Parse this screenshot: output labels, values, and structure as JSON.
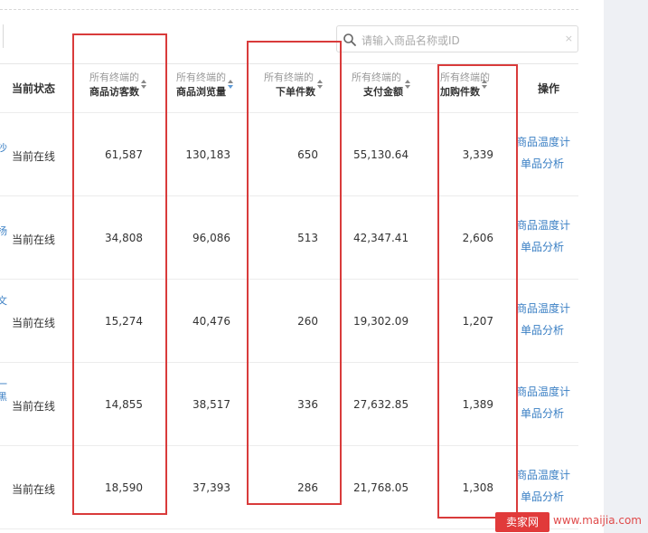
{
  "search": {
    "placeholder": "请输入商品名称或ID",
    "clear_symbol": "×"
  },
  "columns": {
    "status": "当前状态",
    "visitors": {
      "sub": "所有终端的",
      "main": "商品访客数"
    },
    "pageviews": {
      "sub": "所有终端的",
      "main": "商品浏览量"
    },
    "order_items": {
      "sub": "所有终端的",
      "main": "下单件数"
    },
    "payment": {
      "sub": "所有终端的",
      "main": "支付金额"
    },
    "cart_adds": {
      "sub": "所有终端的",
      "main": "加购件数"
    },
    "action": "操作"
  },
  "name_fragments": [
    "沙",
    "杨",
    "文",
    "一",
    "黑"
  ],
  "rows": [
    {
      "status": "当前在线",
      "visitors": "61,587",
      "pageviews": "130,183",
      "order_items": "650",
      "payment": "55,130.64",
      "cart_adds": "3,339",
      "action1": "商品温度计",
      "action2": "单品分析"
    },
    {
      "status": "当前在线",
      "visitors": "34,808",
      "pageviews": "96,086",
      "order_items": "513",
      "payment": "42,347.41",
      "cart_adds": "2,606",
      "action1": "商品温度计",
      "action2": "单品分析"
    },
    {
      "status": "当前在线",
      "visitors": "15,274",
      "pageviews": "40,476",
      "order_items": "260",
      "payment": "19,302.09",
      "cart_adds": "1,207",
      "action1": "商品温度计",
      "action2": "单品分析"
    },
    {
      "status": "当前在线",
      "visitors": "14,855",
      "pageviews": "38,517",
      "order_items": "336",
      "payment": "27,632.85",
      "cart_adds": "1,389",
      "action1": "商品温度计",
      "action2": "单品分析"
    },
    {
      "status": "当前在线",
      "visitors": "18,590",
      "pageviews": "37,393",
      "order_items": "286",
      "payment": "21,768.05",
      "cart_adds": "1,308",
      "action1": "商品温度计",
      "action2": "单品分析"
    }
  ],
  "watermark": {
    "logo": "卖家网",
    "url": "www.maijia.com"
  },
  "colors": {
    "highlight": "#d93b3b",
    "link": "#3a7fc4",
    "sort_active": "#5e9ad6"
  }
}
